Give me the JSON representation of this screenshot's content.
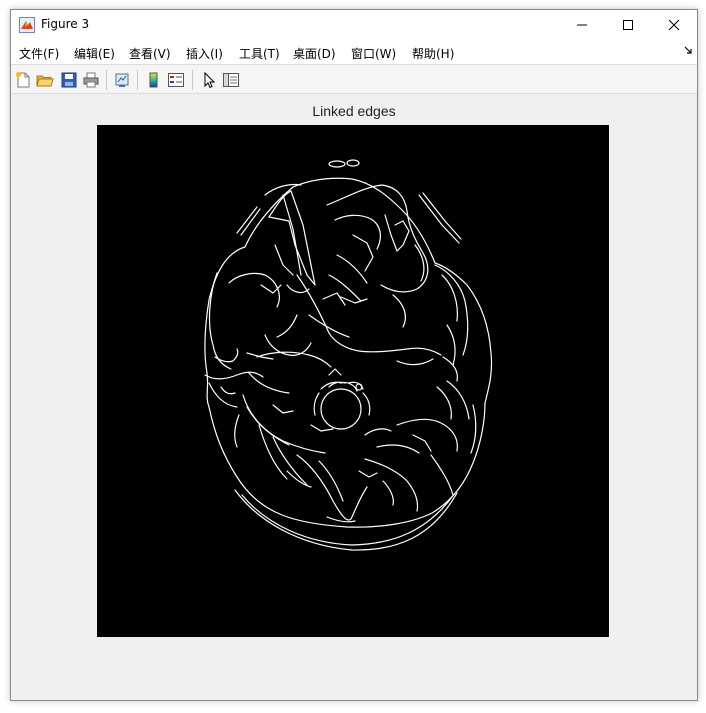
{
  "window": {
    "title": "Figure 3"
  },
  "menubar": {
    "items": [
      "文件(F)",
      "编辑(E)",
      "查看(V)",
      "插入(I)",
      "工具(T)",
      "桌面(D)",
      "窗口(W)",
      "帮助(H)"
    ]
  },
  "toolbar": {
    "buttons": [
      "new-figure-icon",
      "open-file-icon",
      "save-icon",
      "print-icon",
      "link-plot-icon",
      "colorbar-icon",
      "legend-icon",
      "pointer-icon",
      "property-inspector-icon"
    ]
  },
  "axes": {
    "title": "Linked edges",
    "image": "binary edge map of axial head CT slice, white edges on black"
  },
  "colors": {
    "edge": "#ffffff",
    "background": "#000000",
    "window": "#f0f0f0"
  }
}
